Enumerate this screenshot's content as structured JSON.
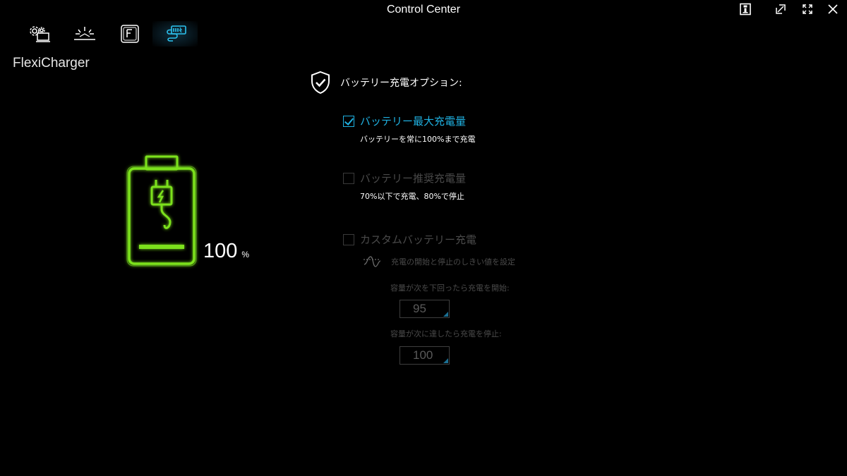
{
  "window": {
    "title": "Control Center",
    "buttons": [
      "info-icon",
      "restore-icon",
      "fullscreen-icon",
      "close-icon"
    ]
  },
  "tabs": [
    {
      "icon": "system-settings-icon",
      "active": false
    },
    {
      "icon": "keyboard-backlight-icon",
      "active": false
    },
    {
      "icon": "function-key-icon",
      "active": false
    },
    {
      "icon": "flexicharger-icon",
      "active": true
    }
  ],
  "section": {
    "title": "FlexiCharger"
  },
  "battery": {
    "icon": "battery-charging-icon",
    "level_percent": 100,
    "value": "100",
    "unit": "%",
    "color": "#7be11f"
  },
  "options": {
    "header": "バッテリー充電オプション:",
    "header_icon": "shield-check-icon",
    "max_charge": {
      "label": "バッテリー最大充電量",
      "desc": "バッテリーを常に100%まで充電",
      "checked": true
    },
    "recommended": {
      "label": "バッテリー推奨充電量",
      "desc": "70%以下で充電、80%で停止",
      "checked": false
    },
    "custom": {
      "label": "カスタムバッテリー充電",
      "checked": false,
      "threshold_icon": "threshold-wave-icon",
      "threshold_text": "充電の開始と停止のしきい値を設定",
      "start_label": "容量が次を下回ったら充電を開始:",
      "start_value": "95",
      "stop_label": "容量が次に達したら充電を停止:",
      "stop_value": "100"
    }
  },
  "colors": {
    "accent": "#1fb0e0",
    "battery": "#7be11f",
    "disabled": "#4a4a4a",
    "background": "#000000"
  }
}
